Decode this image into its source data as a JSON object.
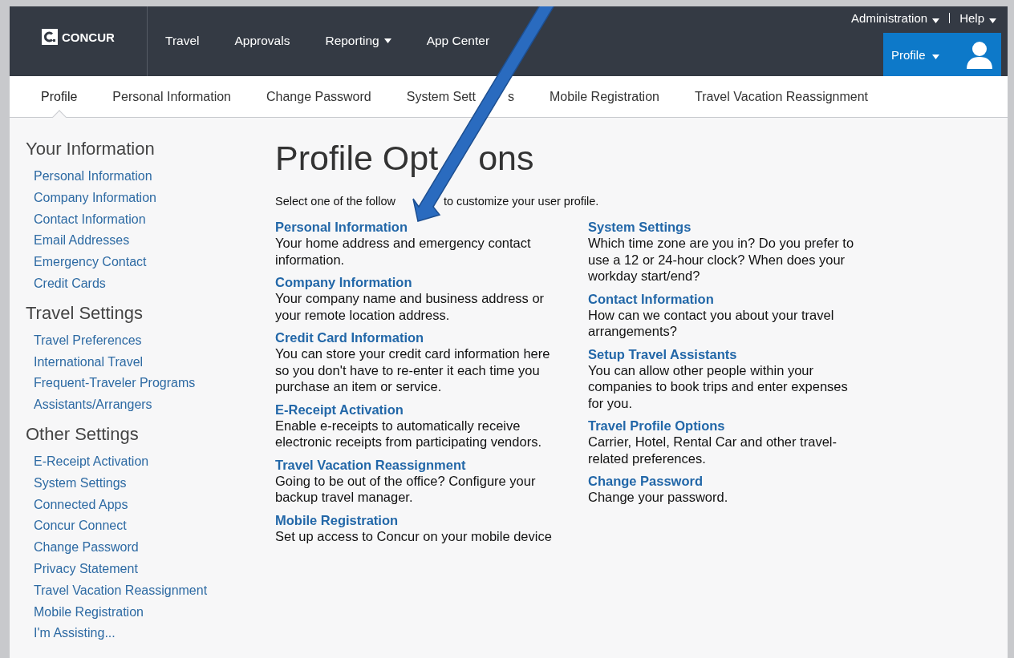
{
  "header": {
    "logo": "CONCUR",
    "nav": [
      {
        "label": "Travel",
        "dropdown": false
      },
      {
        "label": "Approvals",
        "dropdown": false
      },
      {
        "label": "Reporting",
        "dropdown": true
      },
      {
        "label": "App Center",
        "dropdown": false
      }
    ],
    "utility": [
      {
        "label": "Administration"
      },
      {
        "label": "Help"
      }
    ],
    "profile_button": "Profile"
  },
  "subnav": [
    {
      "label": "Profile",
      "selected": true
    },
    {
      "label": "Personal Information",
      "selected": false
    },
    {
      "label": "Change Password",
      "selected": false
    },
    {
      "label_parts": [
        "System Sett",
        "s"
      ],
      "selected": false
    },
    {
      "label": "Mobile Registration",
      "selected": false
    },
    {
      "label": "Travel Vacation Reassignment",
      "selected": false
    }
  ],
  "sidebar": [
    {
      "heading": "Your Information",
      "links": [
        "Personal Information",
        "Company Information",
        "Contact Information",
        "Email Addresses",
        "Emergency Contact",
        "Credit Cards"
      ]
    },
    {
      "heading": "Travel Settings",
      "links": [
        "Travel Preferences",
        "International Travel",
        "Frequent-Traveler Programs",
        "Assistants/Arrangers"
      ]
    },
    {
      "heading": "Other Settings",
      "links": [
        "E-Receipt Activation",
        "System Settings",
        "Connected Apps",
        "Concur Connect",
        "Change Password",
        "Privacy Statement",
        "Travel Vacation Reassignment",
        "Mobile Registration",
        "I'm Assisting..."
      ]
    }
  ],
  "main": {
    "title_parts": [
      "Profile Opt",
      "ons"
    ],
    "intro_parts": [
      "Select one of the follow",
      "to customize your user profile."
    ],
    "columns": [
      [
        {
          "title": "Personal Information",
          "text": "Your home address and emergency contact information."
        },
        {
          "title": "Company Information",
          "text": "Your company name and business address or your remote location address."
        },
        {
          "title": "Credit Card Information",
          "text": "You can store your credit card information here so you don't have to re-enter it each time you purchase an item or service."
        },
        {
          "title": "E-Receipt Activation",
          "text": "Enable e-receipts to automatically receive electronic receipts from participating vendors."
        },
        {
          "title": "Travel Vacation Reassignment",
          "text": "Going to be out of the office? Configure your backup travel manager."
        },
        {
          "title": "Mobile Registration",
          "text": "Set up access to Concur on your mobile device"
        }
      ],
      [
        {
          "title": "System Settings",
          "text": "Which time zone are you in? Do you prefer to use a 12 or 24-hour clock? When does your workday start/end?"
        },
        {
          "title": "Contact Information",
          "text": "How can we contact you about your travel arrangements?"
        },
        {
          "title": "Setup Travel Assistants",
          "text": "You can allow other people within your companies to book trips and enter expenses for you."
        },
        {
          "title": "Travel Profile Options",
          "text": "Carrier, Hotel, Rental Car and other travel-related preferences."
        },
        {
          "title": "Change Password",
          "text": "Change your password."
        }
      ]
    ]
  }
}
